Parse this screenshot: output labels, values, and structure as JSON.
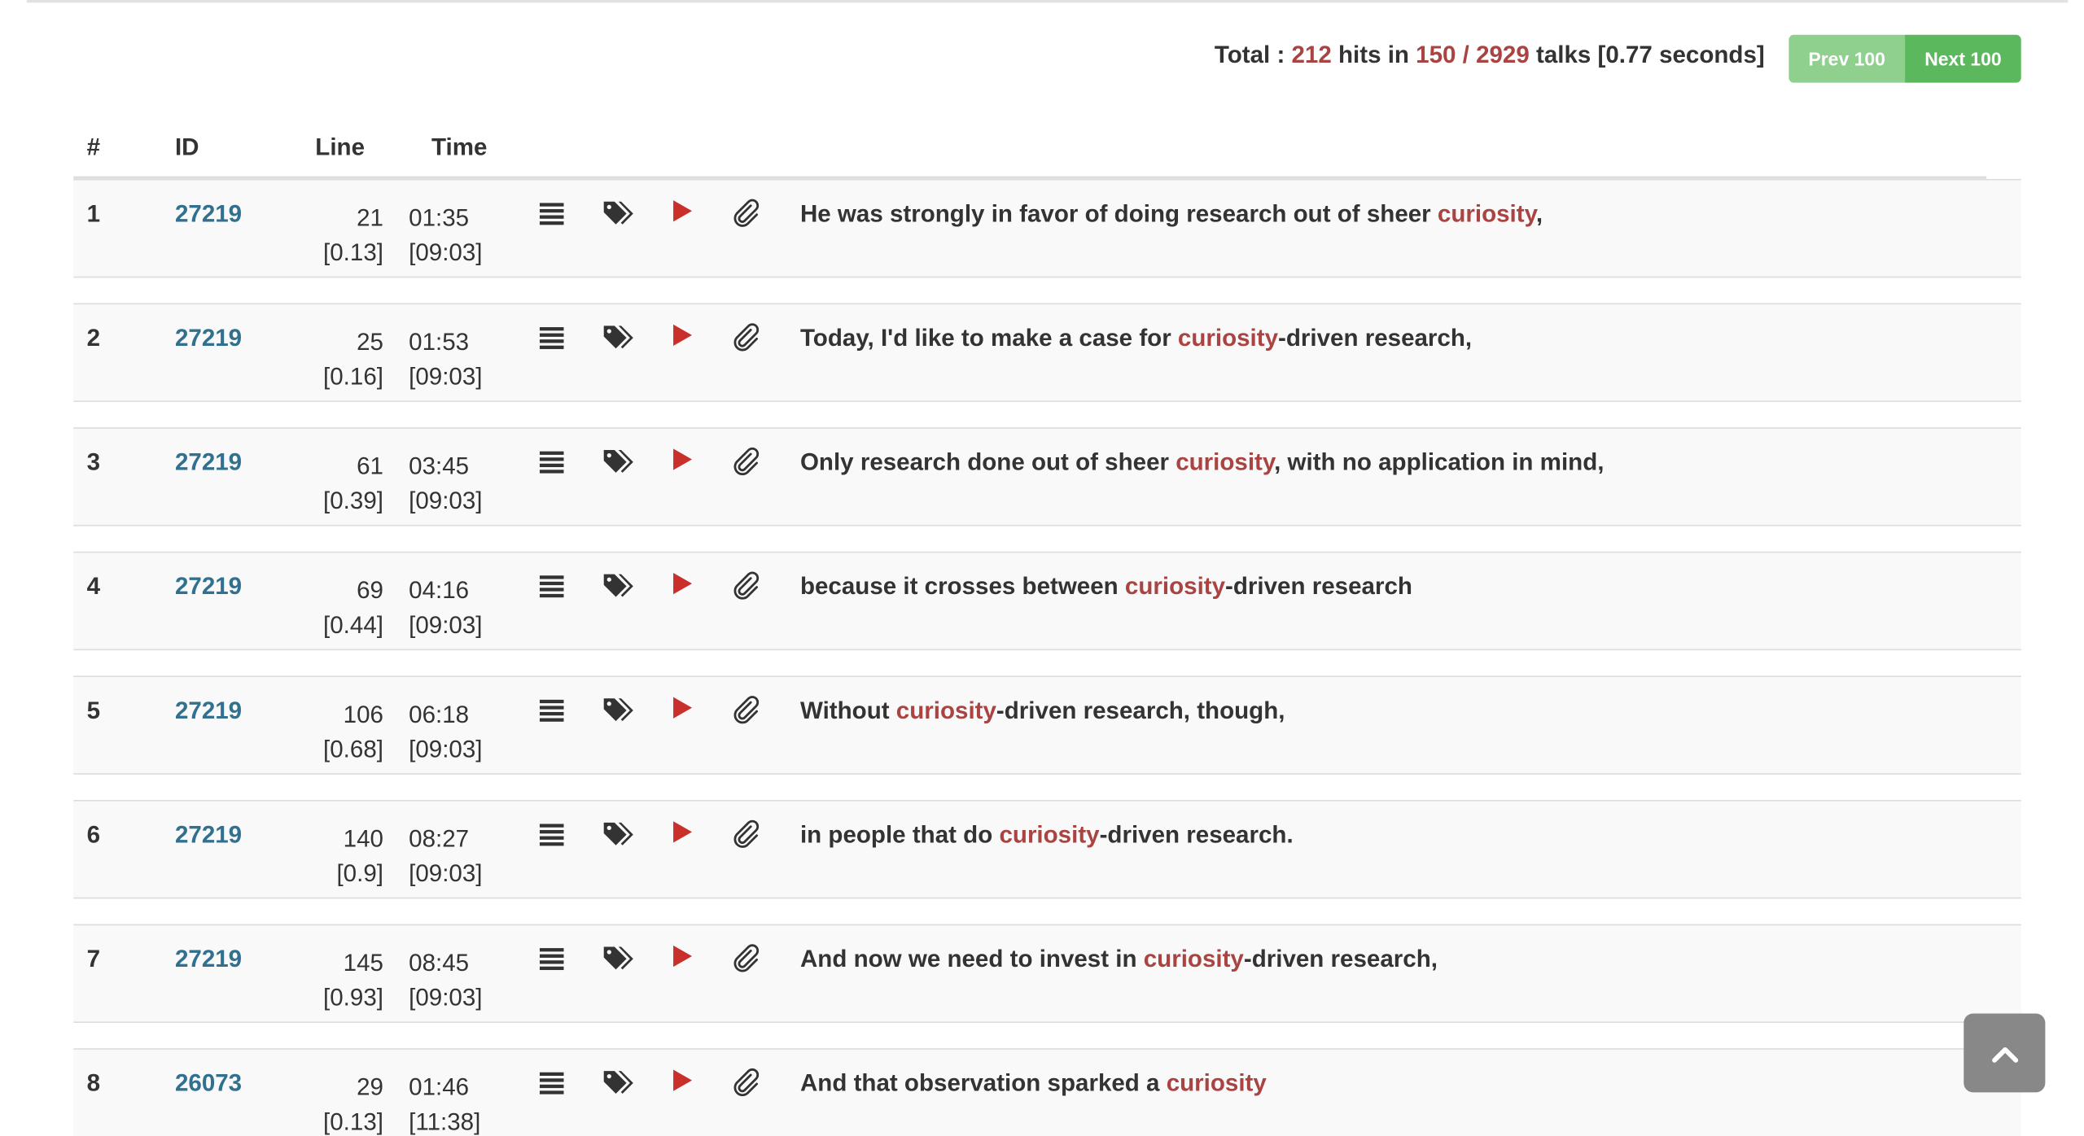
{
  "summary": {
    "prefix": "Total : ",
    "hits": "212",
    "hits_text": " hits in ",
    "talks_ratio": "150 / 2929",
    "talks_text": " talks [0.77 seconds]"
  },
  "pager": {
    "prev_label": "Prev 100",
    "next_label": "Next 100"
  },
  "table": {
    "headers": {
      "num": "#",
      "id": "ID",
      "line": "Line",
      "time": "Time"
    },
    "rows": [
      {
        "num": "1",
        "id": "27219",
        "line": "21",
        "line_ratio": "[0.13]",
        "time": "01:35",
        "duration": "[09:03]",
        "before": "He was strongly in favor of doing research out of sheer ",
        "match": "curiosity",
        "after": ","
      },
      {
        "num": "2",
        "id": "27219",
        "line": "25",
        "line_ratio": "[0.16]",
        "time": "01:53",
        "duration": "[09:03]",
        "before": "Today, I'd like to make a case for ",
        "match": "curiosity",
        "after": "-driven research,"
      },
      {
        "num": "3",
        "id": "27219",
        "line": "61",
        "line_ratio": "[0.39]",
        "time": "03:45",
        "duration": "[09:03]",
        "before": "Only research done out of sheer ",
        "match": "curiosity",
        "after": ", with no application in mind,"
      },
      {
        "num": "4",
        "id": "27219",
        "line": "69",
        "line_ratio": "[0.44]",
        "time": "04:16",
        "duration": "[09:03]",
        "before": "because it crosses between ",
        "match": "curiosity",
        "after": "-driven research"
      },
      {
        "num": "5",
        "id": "27219",
        "line": "106",
        "line_ratio": "[0.68]",
        "time": "06:18",
        "duration": "[09:03]",
        "before": "Without ",
        "match": "curiosity",
        "after": "-driven research, though,"
      },
      {
        "num": "6",
        "id": "27219",
        "line": "140",
        "line_ratio": "[0.9]",
        "time": "08:27",
        "duration": "[09:03]",
        "before": "in people that do ",
        "match": "curiosity",
        "after": "-driven research."
      },
      {
        "num": "7",
        "id": "27219",
        "line": "145",
        "line_ratio": "[0.93]",
        "time": "08:45",
        "duration": "[09:03]",
        "before": "And now we need to invest in ",
        "match": "curiosity",
        "after": "-driven research,"
      },
      {
        "num": "8",
        "id": "26073",
        "line": "29",
        "line_ratio": "[0.13]",
        "time": "01:46",
        "duration": "[11:38]",
        "before": "And that observation sparked a ",
        "match": "curiosity",
        "after": ""
      }
    ]
  },
  "icons": {
    "list": "list-icon",
    "tags": "tags-icon",
    "play": "play-icon",
    "clip": "paperclip-icon",
    "scroll_top": "chevron-up-icon"
  },
  "colors": {
    "highlight": "#a94442",
    "link": "#31708f",
    "prev_button": "#8fd08f",
    "next_button": "#5cb85c",
    "play_icon": "#c9302c"
  }
}
